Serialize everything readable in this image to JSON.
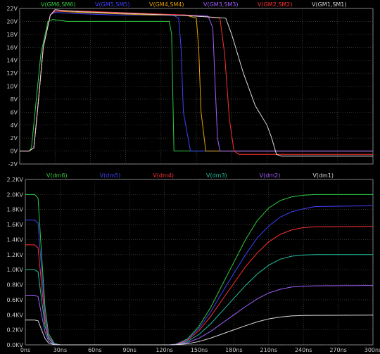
{
  "chart_data": [
    {
      "type": "line",
      "xlim": [
        0,
        300
      ],
      "ylim": [
        -2,
        22
      ],
      "y_ticks": [
        "-2V",
        "0V",
        "2V",
        "4V",
        "6V",
        "8V",
        "10V",
        "12V",
        "14V",
        "16V",
        "18V",
        "20V",
        "22V"
      ],
      "grid": true,
      "legend_position": "top",
      "series": [
        {
          "name": "V(GM6,SM6)",
          "color": "#2ecc40",
          "x": [
            0,
            8,
            10,
            13,
            18,
            24,
            28,
            40,
            60,
            80,
            100,
            120,
            127,
            129,
            131,
            140,
            160,
            190,
            220,
            300
          ],
          "y": [
            0,
            0,
            0.5,
            6,
            15,
            20,
            20.3,
            20,
            20,
            20,
            20,
            20,
            20,
            18,
            0,
            0,
            0,
            0,
            0,
            0
          ]
        },
        {
          "name": "V(GM5,SM5)",
          "color": "#4040ff",
          "x": [
            0,
            8,
            12,
            15,
            20,
            26,
            30,
            50,
            80,
            110,
            130,
            135,
            137,
            139,
            145,
            160,
            190,
            220,
            300
          ],
          "y": [
            0,
            0,
            0.5,
            6,
            16,
            21,
            21.4,
            21.2,
            21,
            21,
            21,
            20.5,
            16,
            6,
            0,
            0,
            0,
            0,
            0
          ]
        },
        {
          "name": "V(GM4,SM4)",
          "color": "#e8a000",
          "x": [
            0,
            8,
            12,
            15,
            20,
            26,
            30,
            50,
            80,
            110,
            140,
            150,
            152,
            154,
            158,
            170,
            200,
            240,
            300
          ],
          "y": [
            0,
            0,
            0.5,
            6,
            16,
            21,
            21.6,
            21.4,
            21.2,
            21,
            21,
            20.5,
            16,
            6,
            0,
            0,
            0,
            0,
            0
          ]
        },
        {
          "name": "V(GM3,SM3)",
          "color": "#a060ff",
          "x": [
            0,
            8,
            12,
            15,
            20,
            26,
            30,
            50,
            80,
            110,
            140,
            160,
            164,
            166,
            168,
            170,
            180,
            200,
            240,
            300
          ],
          "y": [
            0,
            0,
            0.5,
            6,
            16,
            21,
            21.6,
            21.6,
            21.3,
            21.1,
            21,
            20.8,
            19,
            10,
            2,
            0,
            0,
            0,
            0,
            0
          ]
        },
        {
          "name": "V(GM2,SM2)",
          "color": "#ff3030",
          "x": [
            0,
            8,
            12,
            15,
            20,
            26,
            30,
            50,
            80,
            110,
            140,
            170,
            174,
            178,
            182,
            186,
            200,
            240,
            300
          ],
          "y": [
            0,
            0,
            0.5,
            6,
            16,
            21,
            21.6,
            21.6,
            21.4,
            21.2,
            21,
            20.5,
            15,
            5,
            0,
            -0.5,
            -0.5,
            -0.5,
            -0.5
          ]
        },
        {
          "name": "V(GM1,SM1)",
          "color": "#d8d8d8",
          "x": [
            0,
            8,
            12,
            15,
            20,
            26,
            30,
            50,
            80,
            110,
            140,
            160,
            175,
            180,
            190,
            200,
            210,
            214,
            218,
            222,
            260,
            300
          ],
          "y": [
            0,
            0,
            0.5,
            6,
            16,
            21,
            21.8,
            21.5,
            21.3,
            21.1,
            20.9,
            20.7,
            20.5,
            18,
            12,
            7,
            4,
            2,
            -0.5,
            -0.8,
            -0.8,
            -0.8
          ]
        }
      ]
    },
    {
      "type": "line",
      "xlim": [
        0,
        300
      ],
      "ylim": [
        0,
        2200
      ],
      "x_ticks": [
        "0ns",
        "30ns",
        "60ns",
        "90ns",
        "120ns",
        "150ns",
        "180ns",
        "210ns",
        "240ns",
        "270ns",
        "300ns"
      ],
      "y_ticks": [
        "0.0KV",
        "0.2KV",
        "0.4KV",
        "0.6KV",
        "0.8KV",
        "1.0KV",
        "1.2KV",
        "1.4KV",
        "1.6KV",
        "1.8KV",
        "2.0KV",
        "2.2KV"
      ],
      "grid": true,
      "legend_position": "top",
      "series": [
        {
          "name": "V(dm6)",
          "color": "#2ecc40",
          "x": [
            0,
            8,
            11,
            14,
            17,
            20,
            25,
            30,
            60,
            100,
            125,
            130,
            140,
            150,
            160,
            170,
            180,
            190,
            200,
            210,
            220,
            230,
            240,
            250,
            300
          ],
          "y": [
            2000,
            2000,
            1950,
            1200,
            500,
            150,
            20,
            0,
            0,
            0,
            0,
            10,
            80,
            250,
            500,
            800,
            1100,
            1400,
            1650,
            1820,
            1920,
            1970,
            1990,
            2000,
            2000
          ]
        },
        {
          "name": "V(dm5)",
          "color": "#4040ff",
          "x": [
            0,
            8,
            11,
            14,
            17,
            20,
            25,
            30,
            60,
            100,
            125,
            130,
            140,
            150,
            160,
            170,
            180,
            190,
            200,
            210,
            220,
            230,
            240,
            250,
            300
          ],
          "y": [
            1660,
            1660,
            1620,
            1000,
            400,
            120,
            15,
            0,
            0,
            0,
            0,
            10,
            70,
            220,
            440,
            700,
            950,
            1200,
            1420,
            1580,
            1700,
            1770,
            1810,
            1840,
            1850
          ]
        },
        {
          "name": "V(dm4)",
          "color": "#ff3030",
          "x": [
            0,
            8,
            11,
            14,
            17,
            20,
            25,
            30,
            60,
            100,
            125,
            130,
            140,
            150,
            160,
            170,
            180,
            190,
            200,
            210,
            220,
            230,
            240,
            250,
            300
          ],
          "y": [
            1330,
            1330,
            1290,
            800,
            330,
            100,
            12,
            0,
            0,
            0,
            0,
            8,
            60,
            190,
            380,
            600,
            820,
            1040,
            1220,
            1370,
            1470,
            1530,
            1560,
            1570,
            1575
          ]
        },
        {
          "name": "V(dm3)",
          "color": "#20c0a0",
          "x": [
            0,
            8,
            11,
            14,
            17,
            20,
            25,
            30,
            60,
            100,
            125,
            130,
            140,
            150,
            160,
            170,
            180,
            190,
            200,
            210,
            220,
            230,
            240,
            250,
            300
          ],
          "y": [
            1000,
            1000,
            970,
            600,
            250,
            80,
            10,
            0,
            0,
            0,
            0,
            6,
            45,
            140,
            280,
            450,
            620,
            790,
            940,
            1060,
            1140,
            1180,
            1195,
            1200,
            1200
          ]
        },
        {
          "name": "V(dm2)",
          "color": "#a060ff",
          "x": [
            0,
            8,
            11,
            14,
            17,
            20,
            25,
            30,
            60,
            100,
            125,
            130,
            140,
            150,
            160,
            170,
            180,
            190,
            200,
            210,
            220,
            230,
            240,
            250,
            300
          ],
          "y": [
            660,
            660,
            640,
            400,
            170,
            50,
            6,
            0,
            0,
            0,
            0,
            4,
            30,
            90,
            180,
            290,
            400,
            510,
            610,
            690,
            740,
            770,
            780,
            785,
            790
          ]
        },
        {
          "name": "V(dm1)",
          "color": "#d8d8d8",
          "x": [
            0,
            8,
            11,
            14,
            17,
            20,
            25,
            30,
            60,
            100,
            125,
            130,
            140,
            150,
            160,
            170,
            180,
            190,
            200,
            210,
            220,
            230,
            240,
            250,
            300
          ],
          "y": [
            330,
            330,
            320,
            200,
            85,
            25,
            3,
            0,
            0,
            0,
            0,
            2,
            15,
            45,
            90,
            145,
            200,
            255,
            305,
            345,
            370,
            385,
            390,
            392,
            395
          ]
        }
      ]
    }
  ]
}
